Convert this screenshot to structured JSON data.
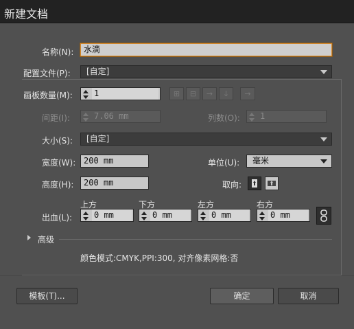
{
  "window": {
    "title": "新建文档"
  },
  "name": {
    "label": "名称(N):",
    "value": "水滴"
  },
  "profile": {
    "label": "配置文件(P):",
    "value": "[自定]"
  },
  "artboards": {
    "count_label": "画板数量(M):",
    "count_value": "1",
    "spacing_label": "间距(I):",
    "spacing_value": "7.06 mm",
    "columns_label": "列数(O):",
    "columns_value": "1",
    "layout_icons": [
      "grid-by-row-icon",
      "grid-by-column-icon",
      "arrange-by-row-icon",
      "arrange-by-column-icon",
      "right-to-left-icon"
    ]
  },
  "size": {
    "label": "大小(S):",
    "value": "[自定]"
  },
  "width": {
    "label": "宽度(W):",
    "value": "200 mm"
  },
  "height": {
    "label": "高度(H):",
    "value": "200 mm"
  },
  "units": {
    "label": "单位(U):",
    "value": "毫米"
  },
  "orientation": {
    "label": "取向:",
    "icons": [
      "portrait-icon",
      "landscape-icon"
    ]
  },
  "bleed": {
    "label": "出血(L):",
    "top_label": "上方",
    "top_value": "0 mm",
    "bottom_label": "下方",
    "bottom_value": "0 mm",
    "left_label": "左方",
    "left_value": "0 mm",
    "right_label": "右方",
    "right_value": "0 mm"
  },
  "advanced": {
    "label": "高级"
  },
  "summary": {
    "text": "颜色模式:CMYK,PPI:300, 对齐像素网格:否"
  },
  "buttons": {
    "templates": "模板(T)...",
    "ok": "确定",
    "cancel": "取消"
  }
}
